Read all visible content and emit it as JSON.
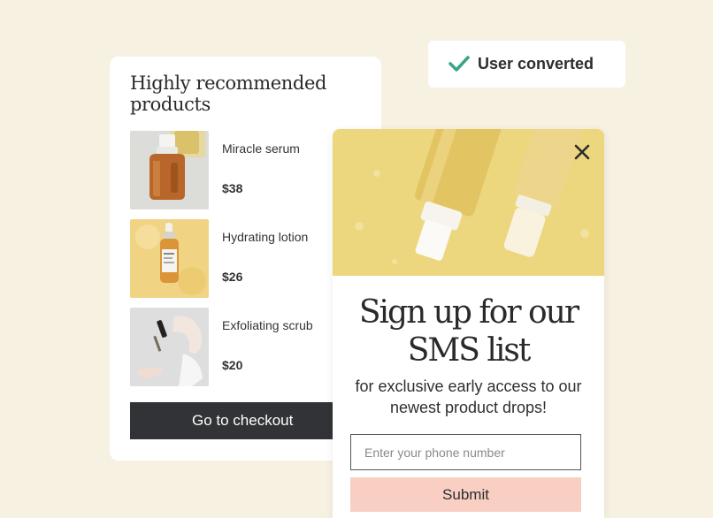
{
  "recommendations": {
    "title": "Highly recommended products",
    "products": [
      {
        "name": "Miracle serum",
        "price": "$38",
        "image_icon": "serum-bottle-image"
      },
      {
        "name": "Hydrating lotion",
        "price": "$26",
        "image_icon": "lotion-bottle-image"
      },
      {
        "name": "Exfoliating scrub",
        "price": "$20",
        "image_icon": "dropper-hand-image"
      }
    ],
    "checkout_label": "Go to checkout"
  },
  "toast": {
    "text": "User converted",
    "icon": "check-icon",
    "accent": "#3aa389"
  },
  "popup": {
    "headline": "Sign up for our SMS list",
    "subtext": "for exclusive early access to our newest product drops!",
    "phone_placeholder": "Enter your phone number",
    "submit_label": "Submit",
    "close_icon": "close-icon",
    "submit_color": "#f8cfc2"
  },
  "colors": {
    "background": "#f7f1e1",
    "checkout": "#323336"
  }
}
